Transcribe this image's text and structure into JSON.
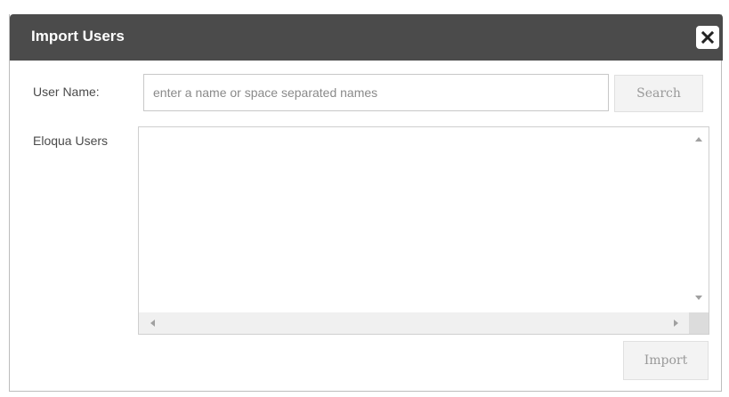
{
  "dialog": {
    "title": "Import Users",
    "close_icon": "close-icon",
    "colors": {
      "titlebar": "#4b4b4b",
      "title_text": "#ffffff",
      "button_bg": "#f3f3f3",
      "button_text": "#999999"
    }
  },
  "form": {
    "username_label": "User Name:",
    "username_value": "",
    "username_placeholder": "enter a name or space separated names",
    "search_label": "Search",
    "users_label": "Eloqua Users",
    "users_list": [],
    "import_label": "Import"
  }
}
